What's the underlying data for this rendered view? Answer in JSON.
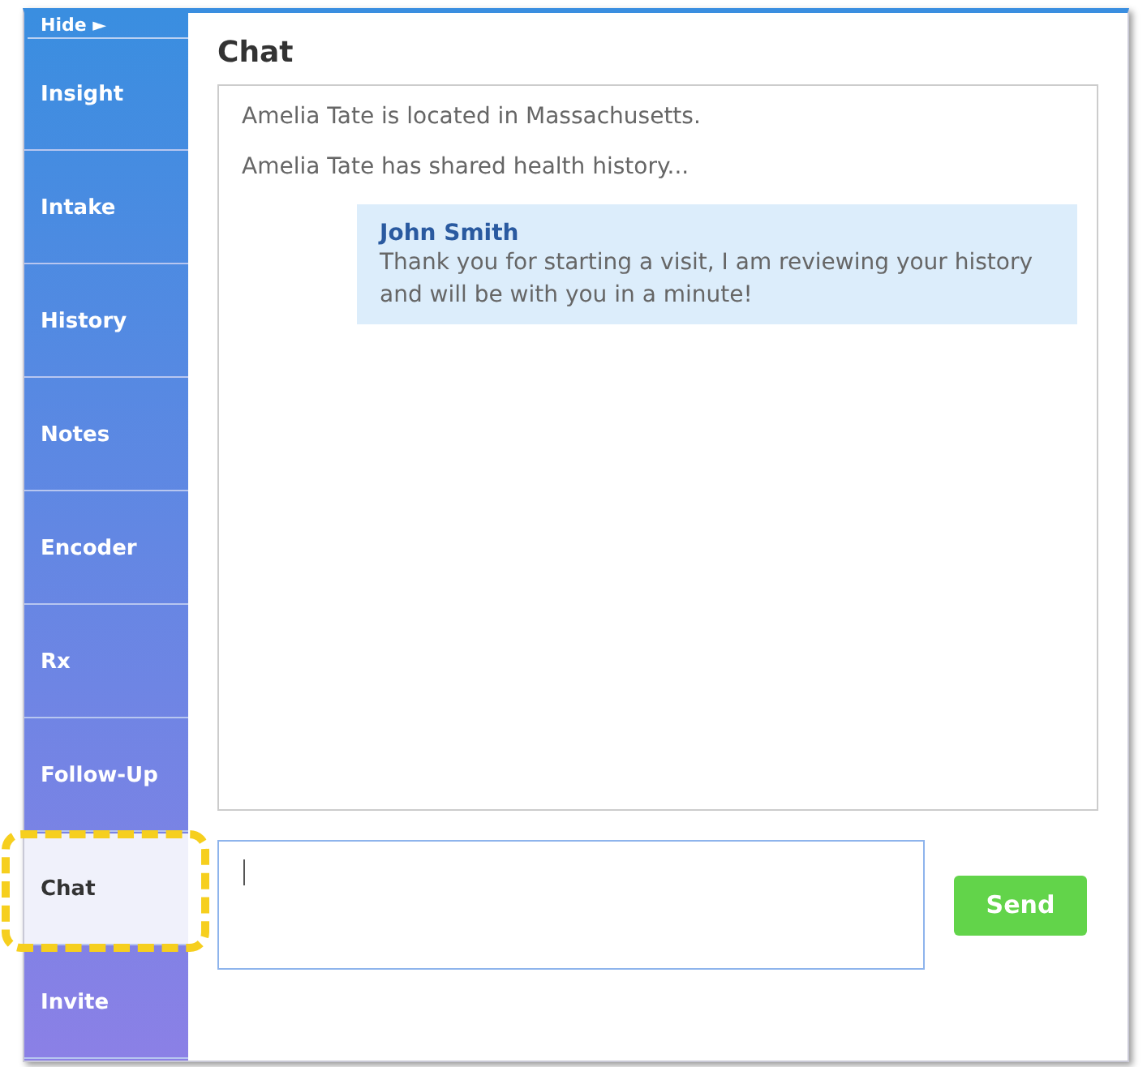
{
  "sidebar": {
    "hide_label": "Hide ►",
    "items": [
      {
        "label": "Insight",
        "selected": false
      },
      {
        "label": "Intake",
        "selected": false
      },
      {
        "label": "History",
        "selected": false
      },
      {
        "label": "Notes",
        "selected": false
      },
      {
        "label": "Encoder",
        "selected": false
      },
      {
        "label": "Rx",
        "selected": false
      },
      {
        "label": "Follow-Up",
        "selected": false
      },
      {
        "label": "Chat",
        "selected": true
      },
      {
        "label": "Invite",
        "selected": false
      }
    ]
  },
  "chat": {
    "title": "Chat",
    "messages": [
      {
        "kind": "system",
        "text": "Amelia Tate is located in Massachusetts."
      },
      {
        "kind": "system",
        "text": "Amelia Tate has shared health history..."
      },
      {
        "kind": "bubble",
        "sender": "John Smith",
        "text": "Thank you for starting a visit, I am reviewing your history and will be with you in a minute!"
      }
    ],
    "send_button": "Send"
  }
}
